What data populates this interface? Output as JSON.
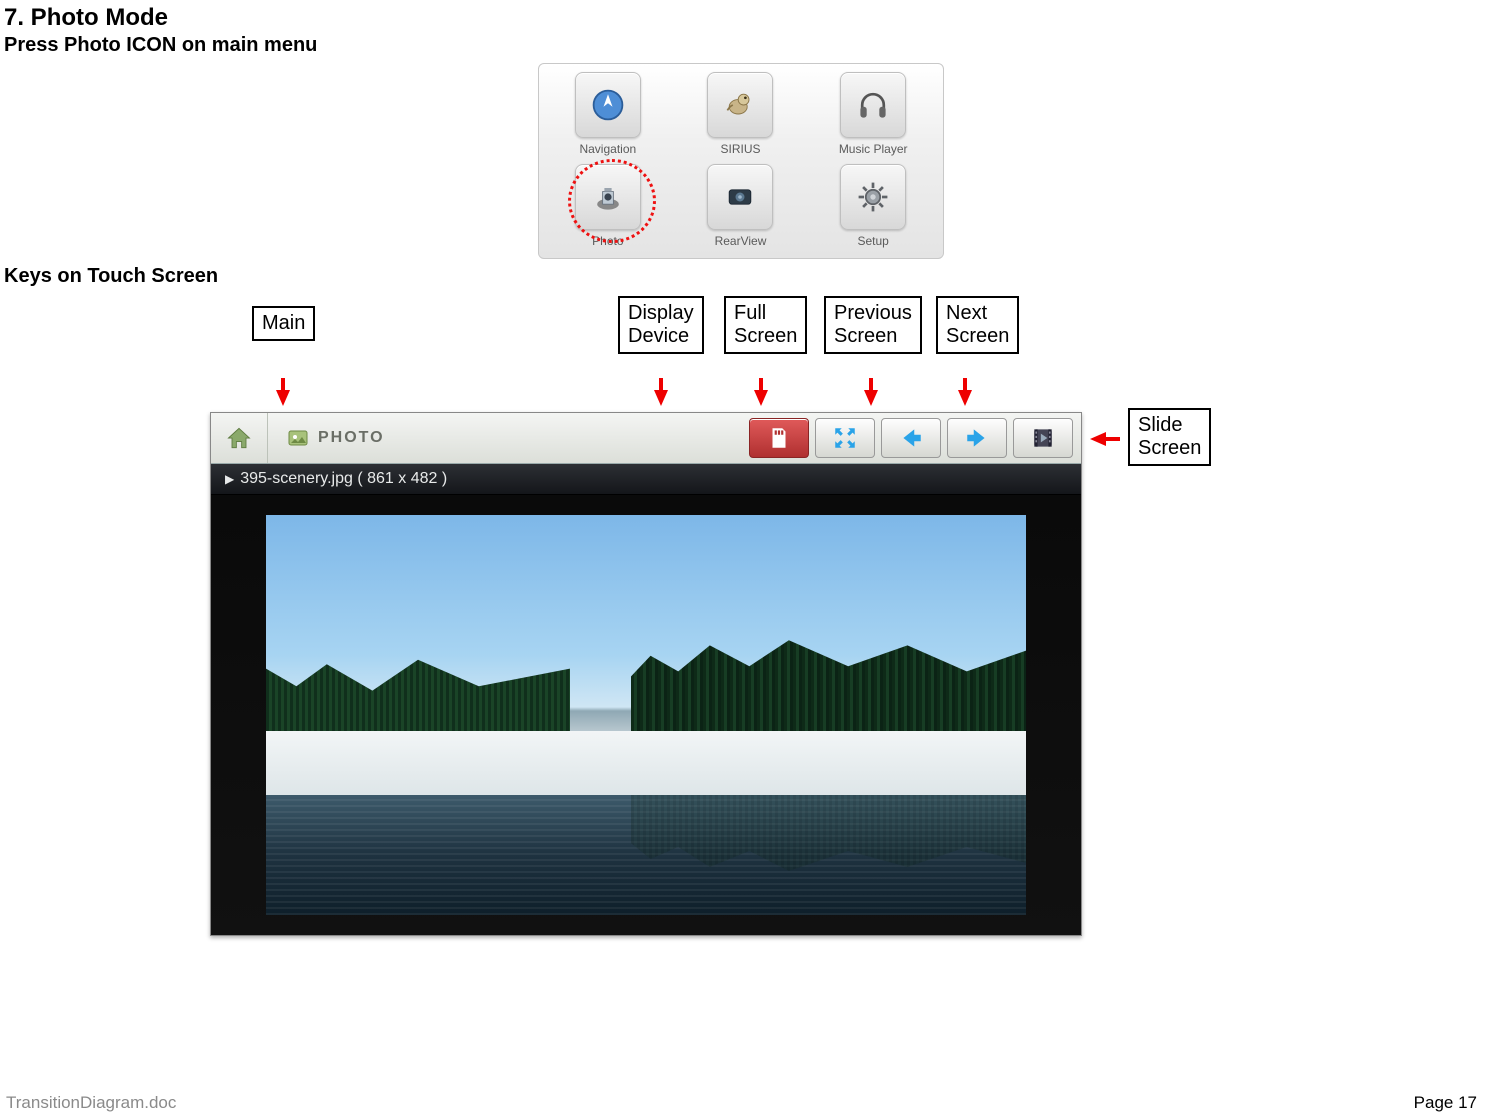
{
  "section": {
    "title": "7. Photo Mode",
    "subtitle": "Press Photo ICON on main menu",
    "keys_title": "Keys on Touch Screen"
  },
  "main_menu": {
    "items": [
      {
        "label": "Navigation"
      },
      {
        "label": "SIRIUS"
      },
      {
        "label": "Music Player"
      },
      {
        "label": "Photo"
      },
      {
        "label": "RearView"
      },
      {
        "label": "Setup"
      }
    ]
  },
  "callouts": {
    "main": "Main",
    "display_device": "Display\nDevice",
    "full_screen": "Full\nScreen",
    "previous_screen": "Previous\nScreen",
    "next_screen": "Next\nScreen",
    "slide_screen": "Slide\nScreen"
  },
  "photo_app": {
    "title": "PHOTO",
    "file_info": "395-scenery.jpg ( 861 x 482 )"
  },
  "footer": {
    "doc": "TransitionDiagram.doc",
    "page": "Page 17"
  }
}
